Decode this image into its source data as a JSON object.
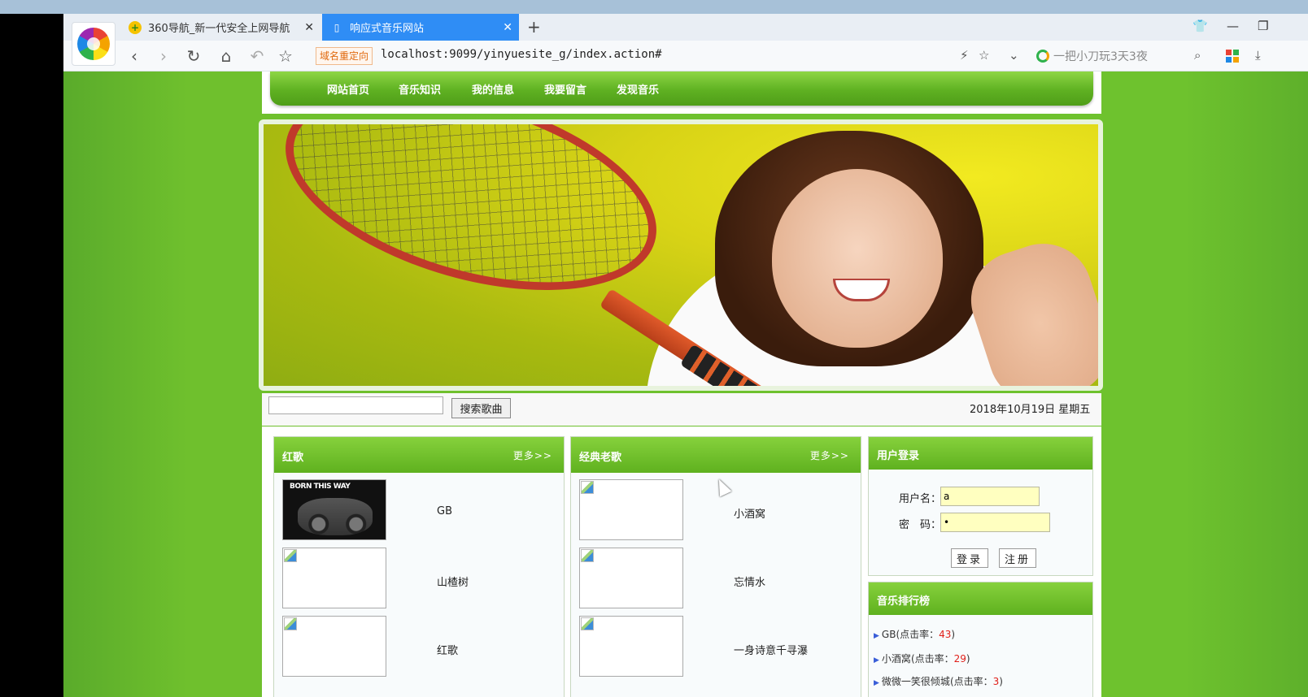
{
  "browser": {
    "tabs": [
      {
        "label": "360导航_新一代安全上网导航",
        "active": false
      },
      {
        "label": "响应式音乐网站",
        "active": true
      }
    ],
    "redirect_badge": "域名重定向",
    "url": "localhost:9099/yinyuesite_g/index.action#",
    "search_hint": "一把小刀玩3天3夜",
    "accent_color": "#2f8df5"
  },
  "site": {
    "nav": [
      "网站首页",
      "音乐知识",
      "我的信息",
      "我要留言",
      "发现音乐"
    ],
    "search": {
      "input_value": "",
      "button_label": "搜索歌曲"
    },
    "date_text": "2018年10月19日 星期五",
    "sections": [
      {
        "title": "红歌",
        "more": "更多>>",
        "songs": [
          {
            "name": "GB",
            "cover": "album",
            "cover_text": "BORN THIS WAY"
          },
          {
            "name": "山楂树",
            "cover": "broken"
          },
          {
            "name": "红歌",
            "cover": "broken"
          }
        ]
      },
      {
        "title": "经典老歌",
        "more": "更多>>",
        "songs": [
          {
            "name": "小酒窝",
            "cover": "broken"
          },
          {
            "name": "忘情水",
            "cover": "broken"
          },
          {
            "name": "一身诗意千寻瀑",
            "cover": "broken"
          }
        ]
      }
    ],
    "login": {
      "title": "用户登录",
      "username_label": "用户名：",
      "username_value": "a",
      "password_label": "密　码：",
      "password_value": "•",
      "login_button": "登录",
      "register_button": "注册"
    },
    "ranking": {
      "title": "音乐排行榜",
      "items": [
        {
          "name": "GB",
          "label": "(点击率：",
          "count": "43",
          "close": ")"
        },
        {
          "name": "小酒窝",
          "label": "(点击率：",
          "count": "29",
          "close": ")"
        },
        {
          "name": "微微一笑很倾城",
          "label": "(点击率：",
          "count": "3",
          "close": ")"
        }
      ]
    },
    "theme_green": "#5fb11f"
  }
}
